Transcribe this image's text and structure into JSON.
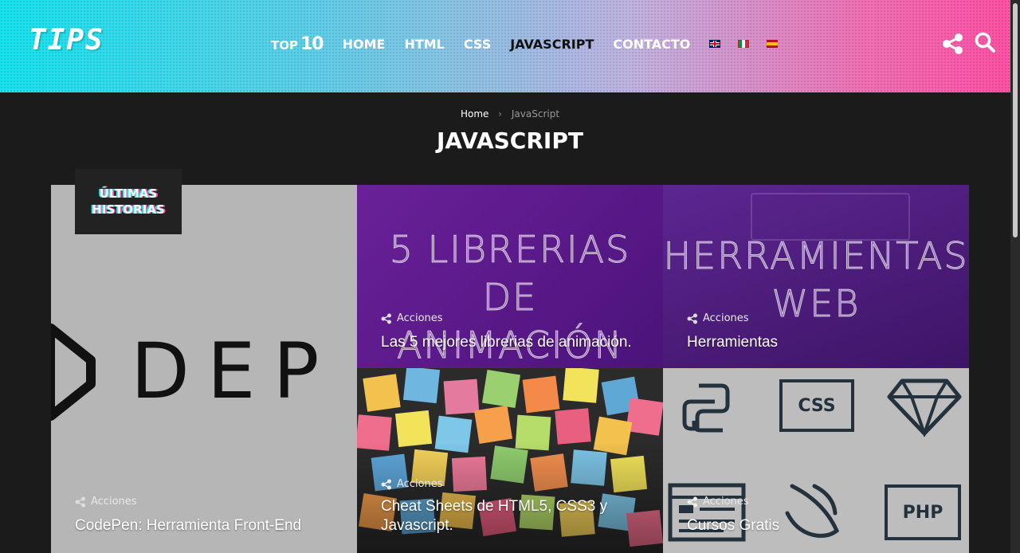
{
  "header": {
    "logo": "TIPS",
    "nav": {
      "top_label": "TOP",
      "top_number": "10",
      "items": [
        "HOME",
        "HTML",
        "CSS",
        "JAVASCRIPT",
        "CONTACTO"
      ],
      "active": "JAVASCRIPT"
    },
    "flags": [
      "en-flag-icon",
      "it-flag-icon",
      "es-flag-icon"
    ],
    "icons": [
      "share-icon",
      "search-icon"
    ]
  },
  "breadcrumb": {
    "home": "Home",
    "separator": "›",
    "current": "JavaScript"
  },
  "page_title": "JAVASCRIPT",
  "badge": {
    "line1": "ÚLTIMAS",
    "line2": "HISTORIAS"
  },
  "cards": [
    {
      "image_text": "DEP",
      "meta": "Acciones",
      "title": "CodePen: Herramienta Front-End"
    },
    {
      "image_text_line1": "5 LIBRERIAS DE",
      "image_text_line2": "ANIMACIÓN",
      "meta": "Acciones",
      "title": "Las 5 mejores librerias de animación."
    },
    {
      "image_text_line1": "HERRAMIENTAS",
      "image_text_line2": "WEB",
      "meta": "Acciones",
      "title": "Herramientas"
    },
    {
      "meta": "Acciones",
      "title": "Cheat Sheets de HTML5, CSS3 y Javascript."
    },
    {
      "icon_labels": [
        "CSS",
        "PHP"
      ],
      "meta": "Acciones",
      "title": "Cursos Gratis"
    }
  ],
  "colors": {
    "accent_cyan": "#17e3ee",
    "accent_pink": "#ff4fa4",
    "background": "#1b1b1b"
  }
}
